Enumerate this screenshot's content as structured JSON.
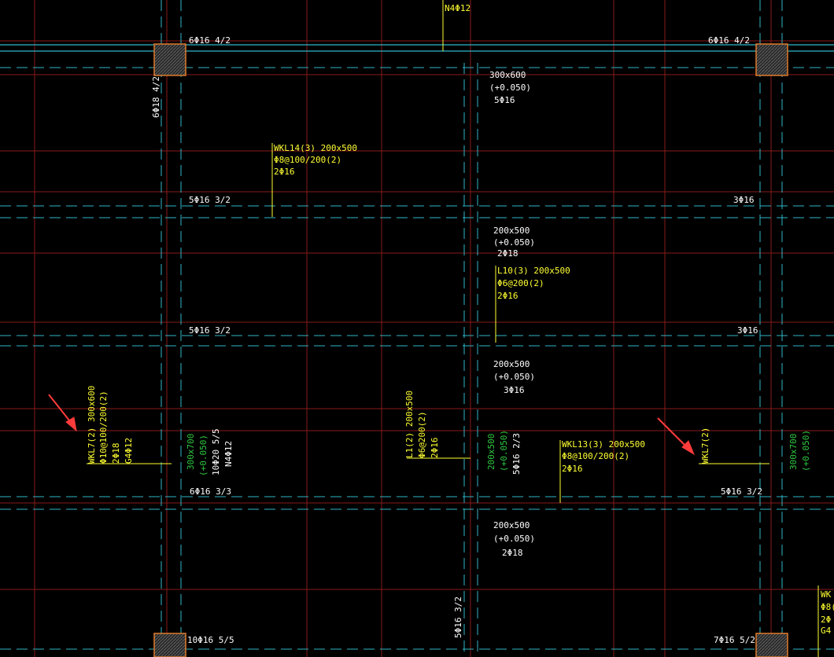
{
  "colors": {
    "background": "#000000",
    "grid_red": "#8a1a1a",
    "dash_cyan": "#2fb6c8",
    "yellow": "#ffff33",
    "white": "#ffffff",
    "green": "#2ecc40",
    "column_fill": "#3a3a3a",
    "column_edge": "#e07b2a",
    "arrow": "#ff3b3b"
  },
  "labels": {
    "top_n4": "N4Φ12",
    "top_left_6phi16": "6Φ16 4/2",
    "top_right_6phi16": "6Φ16 4/2",
    "left_vert_6phi18": "6Φ18 4/2",
    "b300x600": [
      "300x600",
      "(+0.050)",
      "5Φ16"
    ],
    "wkl14": [
      "WKL14(3) 200x500",
      "Φ8@100/200(2)",
      "2Φ16"
    ],
    "row1_left": "5Φ16 3/2",
    "row1_right": "3Φ16",
    "b200x500_a": [
      "200x500",
      "(+0.050)",
      "2Φ18"
    ],
    "l10": [
      "L10(3) 200x500",
      "Φ6@200(2)",
      "2Φ16"
    ],
    "row2_left": "5Φ16 3/2",
    "row2_right": "3Φ16",
    "b200x500_b": [
      "200x500",
      "(+0.050)",
      "3Φ16"
    ],
    "wkl7_left": [
      "WKL7(2) 300x600",
      "Φ10@100/200(2)",
      "2Φ18",
      "G4Φ12"
    ],
    "left_green": [
      "300x700",
      "(+0.050)"
    ],
    "left_white": [
      "10Φ20 5/5",
      "N4Φ12"
    ],
    "l1": [
      "L1(2) 200x500",
      "Φ6@200(2)",
      "2Φ16"
    ],
    "mid_green": [
      "200x500",
      "(+0.050)"
    ],
    "mid_white": "5Φ16 2/3",
    "wkl13": [
      "WKL13(3) 200x500",
      "Φ8@100/200(2)",
      "2Φ16"
    ],
    "wkl7_right": "WKL7(2)",
    "right_green": [
      "300x700",
      "(+0.050)"
    ],
    "row3_left": "6Φ16 3/3",
    "row3_right": "5Φ16 3/2",
    "b200x500_c": [
      "200x500",
      "(+0.050)",
      "2Φ18"
    ],
    "bottom_vert": "5Φ16 3/2",
    "bottom_left": "10Φ16 5/5",
    "bottom_right": "7Φ16 5/2",
    "edge_right_fragments": [
      "WK",
      "Φ8(",
      "2Φ",
      "G4"
    ]
  }
}
